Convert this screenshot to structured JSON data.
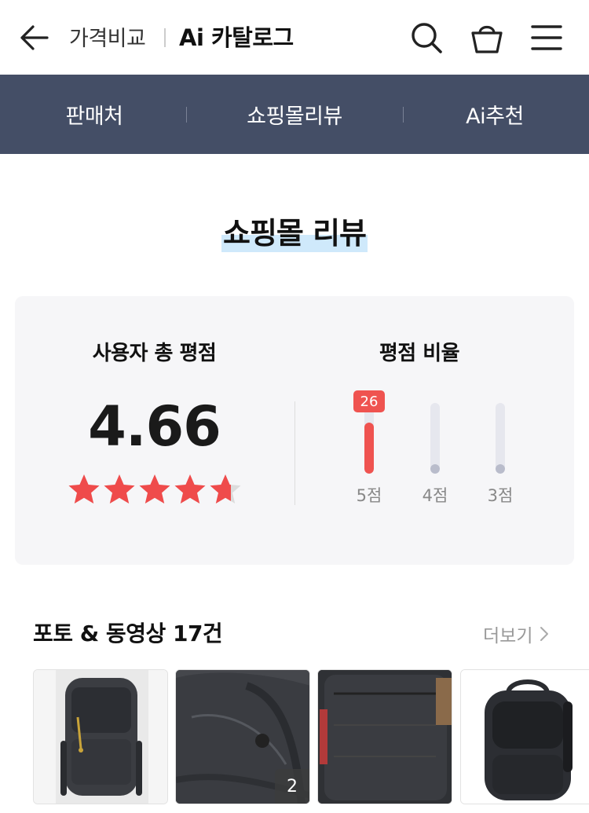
{
  "header": {
    "crumb_label": "가격비교",
    "title": "Ai 카탈로그",
    "icons": [
      "back-arrow-icon",
      "search-icon",
      "shopping-bag-icon",
      "menu-icon"
    ]
  },
  "tabs": [
    {
      "label": "판매처"
    },
    {
      "label": "쇼핑몰리뷰"
    },
    {
      "label": "Ai추천"
    }
  ],
  "section": {
    "title": "쇼핑몰 리뷰"
  },
  "rating": {
    "total_label": "사용자 총 평점",
    "average": "4.66",
    "stars_value": 4.66,
    "stars_max": 5,
    "ratio_label": "평점 비율",
    "bars": [
      {
        "label": "5점",
        "count": "26",
        "fraction": 0.72,
        "active": true
      },
      {
        "label": "4점",
        "count": "",
        "fraction": 0.0,
        "active": false
      },
      {
        "label": "3점",
        "count": "",
        "fraction": 0.0,
        "active": false
      }
    ]
  },
  "photos": {
    "title": "포토 & 동영상 17건",
    "more_label": "더보기",
    "thumbs": [
      {
        "alt": "backpack-photo-1",
        "count": ""
      },
      {
        "alt": "backpack-photo-2",
        "count": "2"
      },
      {
        "alt": "backpack-photo-3",
        "count": ""
      },
      {
        "alt": "backpack-photo-4",
        "count": ""
      }
    ]
  },
  "colors": {
    "tab_bg": "#444e66",
    "star": "#ef4b4b",
    "bar_active": "#ef5350",
    "bar_inactive": "#b9bccb",
    "highlight": "#cfe9fb"
  }
}
